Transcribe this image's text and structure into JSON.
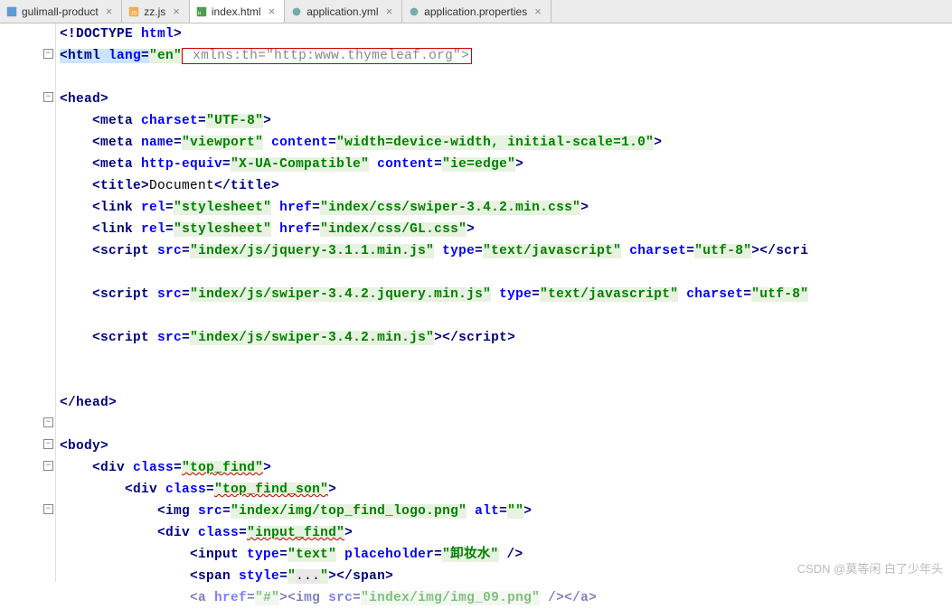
{
  "tabs": [
    {
      "label": "gulimall-product",
      "iconColor": "#5b9bd5"
    },
    {
      "label": "zz.js",
      "iconColor": "#f0ad4e"
    },
    {
      "label": "index.html",
      "iconColor": "#4f9e4f",
      "active": true
    },
    {
      "label": "application.yml",
      "iconColor": "#888"
    },
    {
      "label": "application.properties",
      "iconColor": "#888"
    }
  ],
  "code": {
    "l1": {
      "t1": "<!DOCTYPE ",
      "t2": "html",
      "t3": ">"
    },
    "l2": {
      "t1": "<html ",
      "a1": "lang",
      "v1": "\"en\"",
      "gray": " xmlns:th=\"http:www.thymeleaf.org\">"
    },
    "l4": {
      "t1": "<head>"
    },
    "l5": {
      "t1": "<meta ",
      "a1": "charset",
      "v1": "\"UTF-8\"",
      "t2": ">"
    },
    "l6": {
      "t1": "<meta ",
      "a1": "name",
      "v1": "\"viewport\"",
      "a2": "content",
      "v2": "\"width=device-width, initial-scale=1.0\"",
      "t2": ">"
    },
    "l7": {
      "t1": "<meta ",
      "a1": "http-equiv",
      "v1": "\"X-UA-Compatible\"",
      "a2": "content",
      "v2": "\"ie=edge\"",
      "t2": ">"
    },
    "l8": {
      "t1": "<title>",
      "txt": "Document",
      "t2": "</title>"
    },
    "l9": {
      "t1": "<link ",
      "a1": "rel",
      "v1": "\"stylesheet\"",
      "a2": "href",
      "v2": "\"index/css/swiper-3.4.2.min.css\"",
      "t2": ">"
    },
    "l10": {
      "t1": "<link ",
      "a1": "rel",
      "v1": "\"stylesheet\"",
      "a2": "href",
      "v2": "\"index/css/GL.css\"",
      "t2": ">"
    },
    "l11": {
      "t1": "<script ",
      "a1": "src",
      "v1": "\"index/js/jquery-3.1.1.min.js\"",
      "a2": "type",
      "v2": "\"text/javascript\"",
      "a3": "charset",
      "v3": "\"utf-8\"",
      "t2": "></scri"
    },
    "l13": {
      "t1": "<script ",
      "a1": "src",
      "v1": "\"index/js/swiper-3.4.2.jquery.min.js\"",
      "a2": "type",
      "v2": "\"text/javascript\"",
      "a3": "charset",
      "v3": "\"utf-8\""
    },
    "l15": {
      "t1": "<script ",
      "a1": "src",
      "v1": "\"index/js/swiper-3.4.2.min.js\"",
      "t2": "></scrip",
      "t3": "t>"
    },
    "l18": {
      "t1": "</head>"
    },
    "l21": {
      "t1": "<body>"
    },
    "l22": {
      "t1": "<div ",
      "a1": "class",
      "v1": "\"top_find\"",
      "t2": ">"
    },
    "l23": {
      "t1": "<div ",
      "a1": "class",
      "v1": "\"top_find_son\"",
      "t2": ">"
    },
    "l24": {
      "t1": "<img ",
      "a1": "src",
      "v1": "\"index/img/top_find_logo.png\"",
      "a2": "alt",
      "v2": "\"\"",
      "t2": ">"
    },
    "l25": {
      "t1": "<div ",
      "a1": "class",
      "v1": "\"input_find\"",
      "t2": ">"
    },
    "l26": {
      "t1": "<input ",
      "a1": "type",
      "v1": "\"text\"",
      "a2": "placeholder",
      "v2": "\"卸妆水\"",
      "t2": " />"
    },
    "l27": {
      "t1": "<span ",
      "a1": "style",
      "v1": "\"",
      "ell": "...",
      "v1b": "\"",
      "t2": "></span>"
    },
    "l28": {
      "t1": "<a ",
      "a1": "href",
      "v1": "\"#\"",
      "t2": "><img ",
      "a2": "src",
      "v2": "\"index/img/img_09.png\"",
      "t3": " /></a>"
    }
  },
  "watermark": "CSDN @莫等闲 白了少年头"
}
